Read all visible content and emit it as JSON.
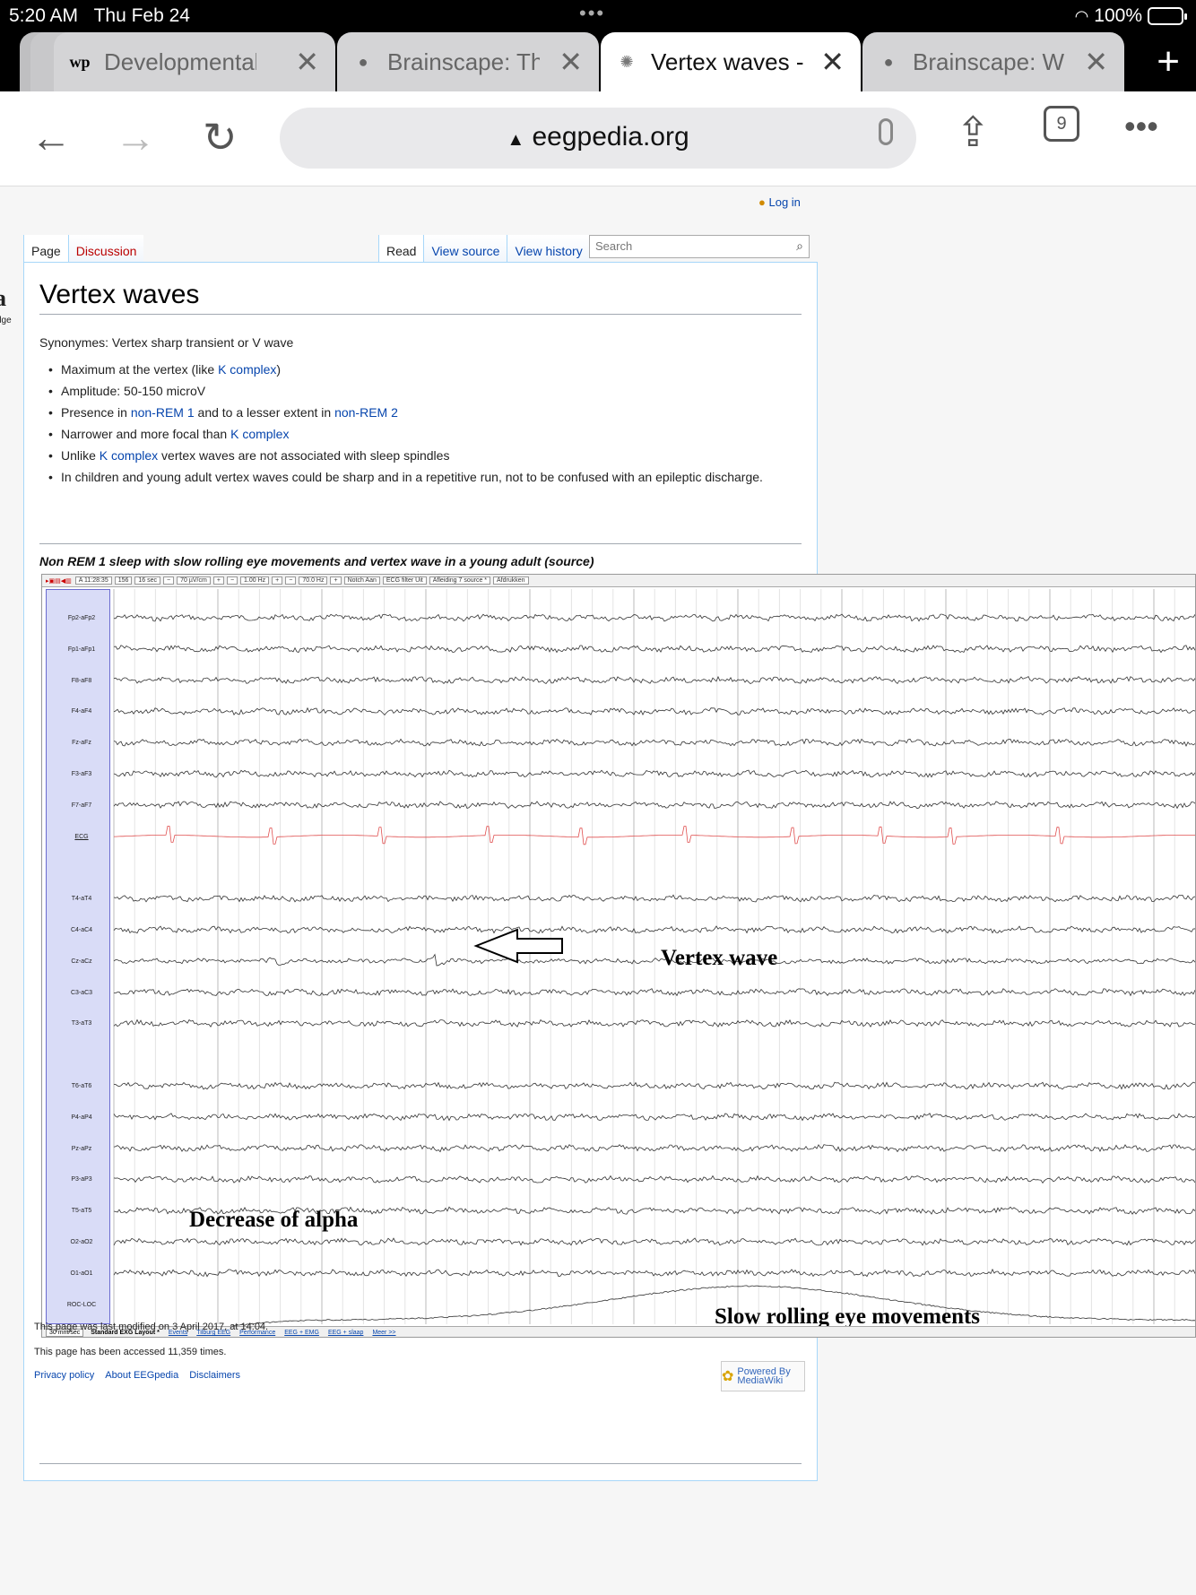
{
  "status": {
    "time": "5:20 AM",
    "date": "Thu Feb 24",
    "battery": "100%"
  },
  "tabs": [
    {
      "title": "Developmental",
      "icon": "wp-icon",
      "active": false
    },
    {
      "title": "Brainscape: Th",
      "icon": "brainscape-icon",
      "active": false
    },
    {
      "title": "Vertex waves -",
      "icon": "brain-icon",
      "active": true
    },
    {
      "title": "Brainscape: Wh",
      "icon": "brainscape-icon",
      "active": false
    }
  ],
  "toolbar": {
    "url": "eegpedia.org",
    "tab_count": "9"
  },
  "page": {
    "login": "Log in",
    "left_fragment": "a",
    "left_fragment2": "dge",
    "tabs": {
      "page": "Page",
      "discussion": "Discussion",
      "read": "Read",
      "view_source": "View source",
      "view_history": "View history"
    },
    "search_placeholder": "Search",
    "title": "Vertex waves",
    "synonyms": "Synonymes: Vertex sharp transient or V wave",
    "bullets": {
      "b1_pre": "Maximum at the vertex (like ",
      "b1_link": "K complex",
      "b1_post": ")",
      "b2": "Amplitude: 50-150 microV",
      "b3_pre": "Presence in ",
      "b3_link1": "non-REM 1",
      "b3_mid": " and to a lesser extent in ",
      "b3_link2": "non-REM 2",
      "b4_pre": "Narrower and more focal than ",
      "b4_link": "K complex",
      "b5_pre": "Unlike ",
      "b5_link": "K complex",
      "b5_post": " vertex waves are not associated with sleep spindles",
      "b6": "In children and young adult vertex waves could be sharp and in a repetitive run, not to be confused with an epileptic discharge."
    },
    "caption": "Non REM 1 sleep with slow rolling eye movements and vertex wave in a young adult (source)",
    "eeg": {
      "toolbar": [
        "A 11:28:35",
        "156",
        "16 sec",
        "−",
        "70 µV/cm",
        "+",
        "−",
        "1.00 Hz",
        "+",
        "−",
        "70.0 Hz",
        "+",
        "Notch Aan",
        "ECG filter Uit",
        "Afleiding 7 source *",
        "Afdrukken"
      ],
      "channels": [
        "Fp2-aFp2",
        "Fp1-aFp1",
        "F8-aF8",
        "F4-aF4",
        "Fz-aFz",
        "F3-aF3",
        "F7-aF7",
        "ECG",
        "T4-aT4",
        "C4-aC4",
        "Cz-aCz",
        "C3-aC3",
        "T3-aT3",
        "T6-aT6",
        "P4-aP4",
        "Pz-aPz",
        "P3-aP3",
        "T5-aT5",
        "O2-aO2",
        "O1-aO1",
        "ROC-LOC"
      ],
      "annotations": {
        "vertex": "Vertex wave",
        "alpha": "Decrease of alpha",
        "eye": "Slow rolling eye movements"
      },
      "bottom_speed": "30 mm/sec",
      "bottom_tabs": [
        "Standard EXG Layout *",
        "Events",
        "Tilburg EEG",
        "Performance",
        "EEG + EMG",
        "EEG + slaap",
        "Meer >>"
      ],
      "ecg_color": "#e05050"
    },
    "footer": {
      "modified": "This page was last modified on 3 April 2017, at 14:04.",
      "accessed": "This page has been accessed 11,359 times.",
      "links": [
        "Privacy policy",
        "About EEGpedia",
        "Disclaimers"
      ],
      "mediawiki": "Powered By MediaWiki"
    }
  }
}
